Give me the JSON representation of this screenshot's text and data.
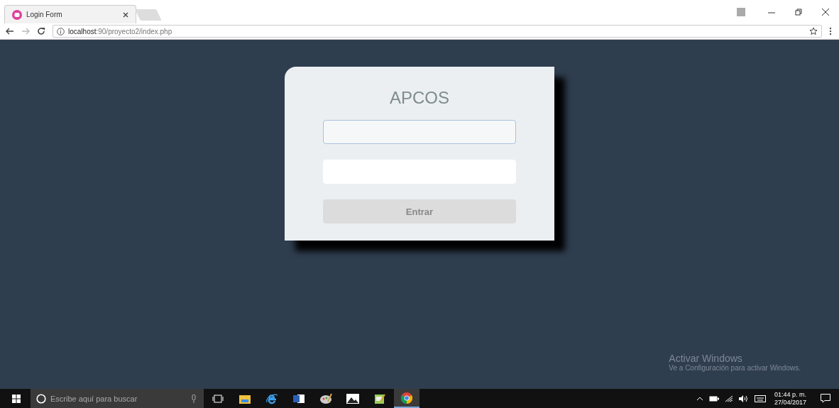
{
  "browser": {
    "tab": {
      "title": "Login Form"
    },
    "address": {
      "host": "localhost",
      "path": ":90/proyecto2/index.php"
    }
  },
  "login": {
    "title": "APCOS",
    "fields": [
      {
        "focused": true
      },
      {
        "focused": false
      }
    ],
    "button": "Entrar"
  },
  "activation": {
    "title": "Activar Windows",
    "message": "Ve a Configuración para activar Windows."
  },
  "taskbar": {
    "search": {
      "placeholder": "Escribe aquí para buscar"
    },
    "apps": [
      {
        "kind": "taskview",
        "selected": false
      },
      {
        "kind": "folder",
        "selected": false
      },
      {
        "kind": "ie",
        "selected": false
      },
      {
        "kind": "word",
        "selected": false
      },
      {
        "kind": "paint",
        "selected": false
      },
      {
        "kind": "photos",
        "selected": false
      },
      {
        "kind": "notes",
        "selected": false
      },
      {
        "kind": "chrome",
        "selected": true
      }
    ],
    "time": "01:44 p. m.",
    "date": "27/04/2017"
  }
}
